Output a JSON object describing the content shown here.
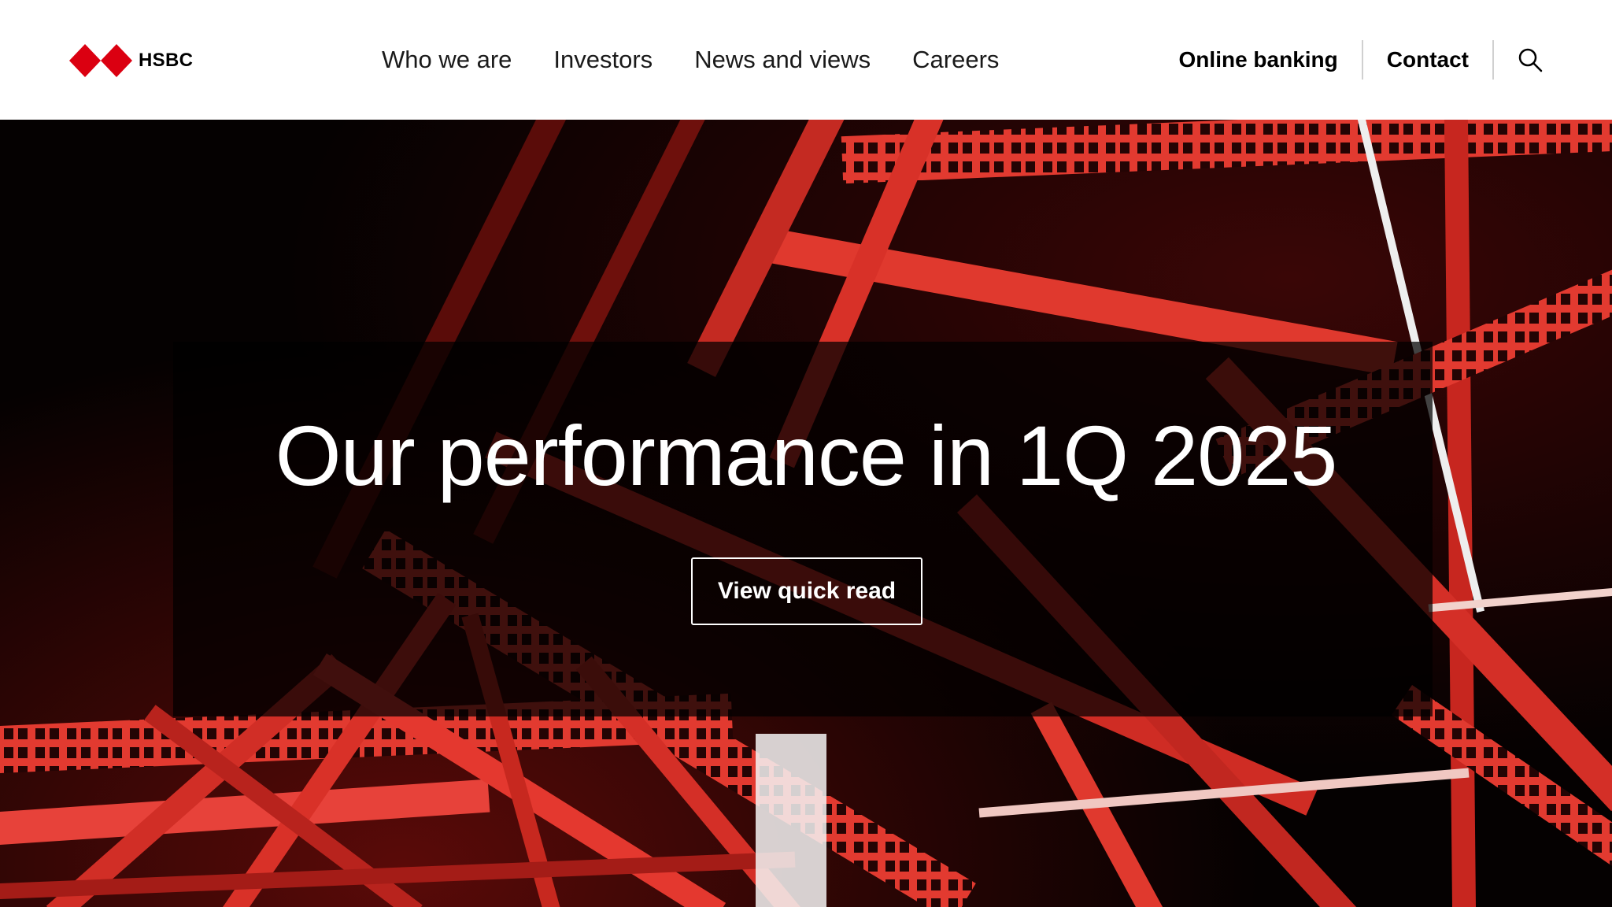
{
  "header": {
    "logo": {
      "text": "HSBC",
      "brand_color": "#db0011"
    },
    "nav": [
      {
        "label": "Who we are"
      },
      {
        "label": "Investors"
      },
      {
        "label": "News and views"
      },
      {
        "label": "Careers"
      }
    ],
    "utility": {
      "online_banking": "Online banking",
      "contact": "Contact",
      "search_icon": "search-icon"
    }
  },
  "hero": {
    "headline": "Our performance in 1Q 2025",
    "cta_label": "View quick read",
    "accent_color": "#e8302a"
  }
}
